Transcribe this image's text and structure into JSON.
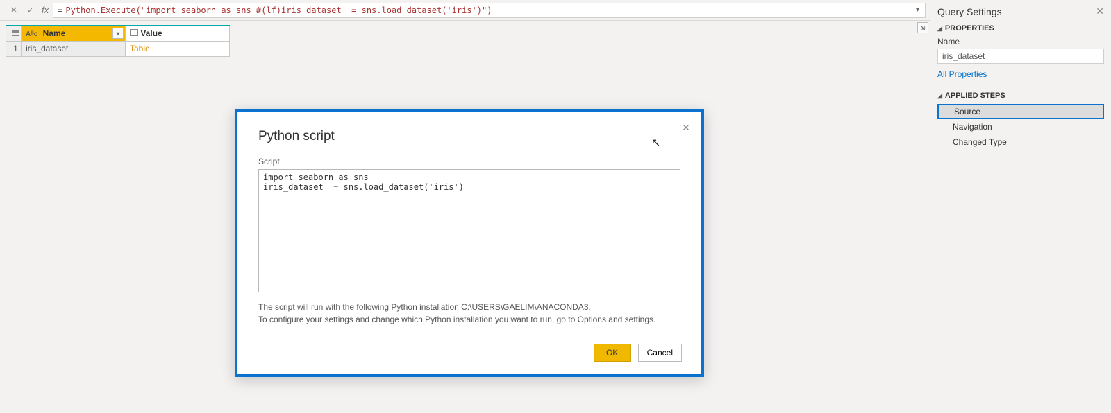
{
  "formula_bar": {
    "fx_label": "fx",
    "expression": "= Python.Execute(\"import seaborn as sns #(lf)iris_dataset  = sns.load_dataset('iris')\")"
  },
  "columns": {
    "name_header": "Name",
    "value_header": "Value"
  },
  "rows": [
    {
      "index": "1",
      "name": "iris_dataset",
      "value": "Table"
    }
  ],
  "dialog": {
    "title": "Python script",
    "script_label": "Script",
    "script_text": "import seaborn as sns\niris_dataset  = sns.load_dataset('iris')",
    "info_line1": "The script will run with the following Python installation C:\\USERS\\GAELIM\\ANACONDA3.",
    "info_line2": "To configure your settings and change which Python installation you want to run, go to Options and settings.",
    "ok_label": "OK",
    "cancel_label": "Cancel"
  },
  "settings": {
    "pane_title": "Query Settings",
    "properties_header": "PROPERTIES",
    "name_label": "Name",
    "name_value": "iris_dataset",
    "all_properties": "All Properties",
    "applied_steps_header": "APPLIED STEPS",
    "steps": [
      {
        "label": "Source",
        "selected": true
      },
      {
        "label": "Navigation",
        "selected": false
      },
      {
        "label": "Changed Type",
        "selected": false
      }
    ]
  }
}
